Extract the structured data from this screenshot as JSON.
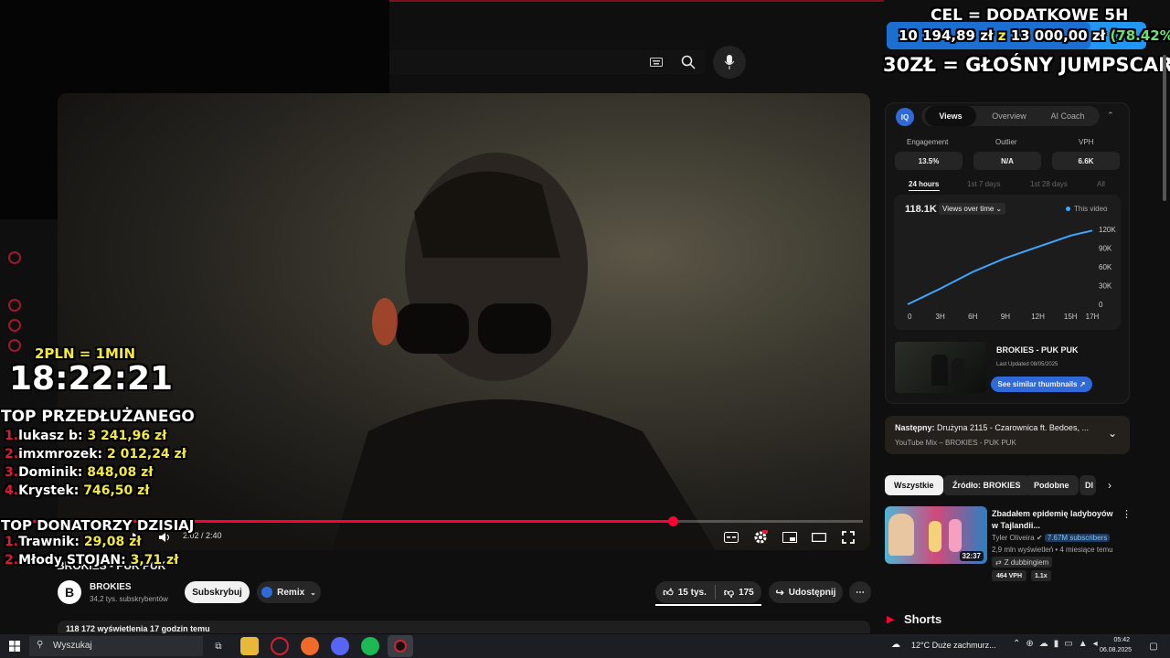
{
  "goal": {
    "title": "CEL = DODATKOWE 5H",
    "amount_text": "10 194,89 zł",
    "of_text": "z",
    "target_text": "13 000,00 zł",
    "percent_text": "(78.42%)",
    "progress_fraction": 0.7842
  },
  "jumpscare": "30ZŁ = GŁOŚNY JUMPSCARE",
  "timer": {
    "rate": "2PLN = 1MIN",
    "value": "18:22:21"
  },
  "top_extended": {
    "title": "TOP PRZEDŁUŻANEGO",
    "entries": [
      {
        "rank": "1.",
        "name": "lukasz b:",
        "amount": "3 241,96 zł"
      },
      {
        "rank": "2.",
        "name": "imxmrozek:",
        "amount": "2 012,24 zł"
      },
      {
        "rank": "3.",
        "name": "Dominik:",
        "amount": "848,08 zł"
      },
      {
        "rank": "4.",
        "name": "Krystek:",
        "amount": "746,50 zł"
      }
    ]
  },
  "top_donors": {
    "title": "TOP DONATORZY DZISIAJ",
    "entries": [
      {
        "rank": "1.",
        "name": "Trawnik:",
        "amount": "29,08 zł"
      },
      {
        "rank": "2.",
        "name": "Młody STOJAN:",
        "amount": "3,71 zł"
      }
    ]
  },
  "player": {
    "time": "2:02 / 2:40",
    "progress_fraction": 0.78
  },
  "video": {
    "title": "BROKIES - PUK PUK",
    "channel": "BROKIES",
    "subs": "34,2 tys. subskrybentów",
    "subscribe": "Subskrybuj",
    "remix": "Remix",
    "likes": "15 tys.",
    "dislikes": "175",
    "share": "Udostępnij",
    "views_line": "118 172 wyświetlenia  17 godzin temu"
  },
  "iq": {
    "tabs": [
      "Views",
      "Overview",
      "AI Coach"
    ],
    "stats": [
      {
        "label": "Engagement",
        "value": "13.5%"
      },
      {
        "label": "Outlier",
        "value": "N/A"
      },
      {
        "label": "VPH",
        "value": "6.6K"
      }
    ],
    "ranges": [
      "24 hours",
      "1st 7 days",
      "1st 28 days",
      "All"
    ],
    "total": "118.1K",
    "views_dropdown": "Views over time",
    "legend": "This video",
    "thumb_title": "BROKIES - PUK PUK",
    "last_updated": "Last Updated 08/05/2025",
    "similar_btn": "See similar thumbnails ↗"
  },
  "chart_data": {
    "type": "line",
    "x": [
      "0",
      "3H",
      "6H",
      "9H",
      "12H",
      "15H",
      "17H"
    ],
    "series": [
      {
        "name": "This video",
        "values": [
          0,
          25000,
          52000,
          74000,
          92000,
          110000,
          118100
        ]
      }
    ],
    "yticks": [
      "120K",
      "90K",
      "60K",
      "30K",
      "0"
    ],
    "ylim": [
      0,
      120000
    ],
    "grid": false,
    "legend": "top-right",
    "color": "#3ea6ff"
  },
  "up_next": {
    "line1_prefix": "Następny:",
    "line1_rest": "Drużyna 2115 - Czarownica ft. Bedoes, ...",
    "line2": "YouTube Mix – BROKIES - PUK PUK"
  },
  "chips": [
    "Wszystkie",
    "Źródło: BROKIES",
    "Podobne",
    "Dl"
  ],
  "rec": {
    "title": "Zbadałem epidemię ladyboyów w Tajlandii...",
    "channel": "Tyler Oliveira",
    "subs": "7.67M subscribers",
    "meta": "2,9 mln wyświetleń • 4 miesiące temu",
    "dub": "Z dubbingiem",
    "vph": "464 VPH",
    "mult": "1.1x",
    "duration": "32:37"
  },
  "shorts": "Shorts",
  "taskbar": {
    "search": "Wyszukaj",
    "weather": "12°C  Duże zachmurz...",
    "time": "05:42",
    "date": "06.08.2025"
  },
  "colors": {
    "accent_red": "#ff0033",
    "overlay_rank": "#e0183a",
    "overlay_amount": "#f5ea3c",
    "goal_green": "#6fe06f",
    "blue": "#3ea6ff"
  }
}
